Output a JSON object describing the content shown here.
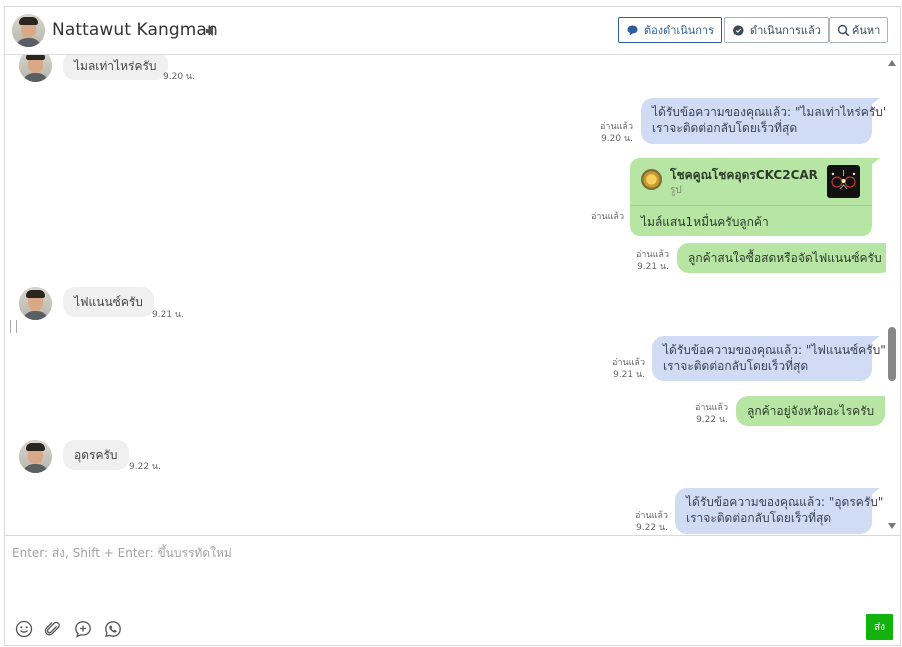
{
  "header": {
    "contact_name": "Nattawut Kangman",
    "speaker_icon": "speaker-icon",
    "btn_todo": "ต้องดำเนินการ",
    "btn_done": "ดำเนินการแล้ว",
    "btn_search": "ค้นหา"
  },
  "messages": {
    "m1": {
      "text": "ไมลเท่าไหร่ครับ",
      "time": "9.20 น."
    },
    "m2": {
      "line1": "ได้รับข้อความของคุณแล้ว: \"ไมลเท่าไหร่ครับ\"",
      "line2": "เราจะติดต่อกลับโดยเร็วที่สุด",
      "read": "อ่านแล้ว",
      "time": "9.20 น."
    },
    "m3": {
      "shop": "โชคคูณโชคอุดรCKC2CAR",
      "type": "รูป",
      "text": "ไมล์แสน1หมื่นครับลูกค้า",
      "read": "อ่านแล้ว"
    },
    "m4": {
      "text": "ลูกค้าสนใจซื้อสดหรือจัดไฟแนนซ์ครับ",
      "read": "อ่านแล้ว",
      "time": "9.21 น."
    },
    "m5": {
      "text": "ไฟแนนซ์ครับ",
      "time": "9.21 น."
    },
    "m6": {
      "line1": "ได้รับข้อความของคุณแล้ว: \"ไฟแนนซ์ครับ\"",
      "line2": "เราจะติดต่อกลับโดยเร็วที่สุด",
      "read": "อ่านแล้ว",
      "time": "9.21 น."
    },
    "m7": {
      "text": "ลูกค้าอยู่จังหวัดอะไรครับ",
      "read": "อ่านแล้ว",
      "time": "9.22 น."
    },
    "m8": {
      "text": "อุดรครับ",
      "time": "9.22 น."
    },
    "m9": {
      "line1": "ได้รับข้อความของคุณแล้ว: \"อุดรครับ\"",
      "line2": "เราจะติดต่อกลับโดยเร็วที่สุด",
      "read": "อ่านแล้ว",
      "time": "9.22 น."
    }
  },
  "composer": {
    "placeholder": "Enter: ส่ง, Shift + Enter: ขึ้นบรรทัดใหม่",
    "send_label": "ส่ง"
  },
  "colors": {
    "accent": "#2d5f9e",
    "send": "#12b30f",
    "bubble_blue": "#cfdcf4",
    "bubble_green": "#b7e6a4",
    "bubble_grey": "#f0f0f0"
  }
}
